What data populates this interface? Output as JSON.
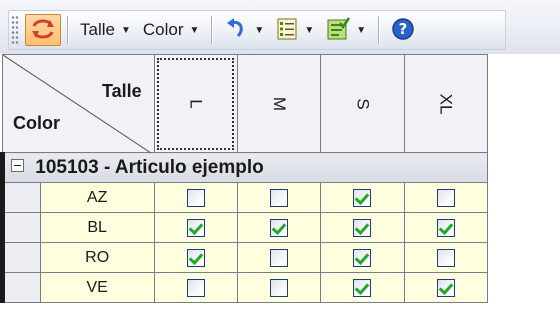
{
  "toolbar": {
    "talle_label": "Talle",
    "color_label": "Color",
    "icons": [
      "swap-icon",
      "undo-icon",
      "list-icon",
      "checklist-icon",
      "help-icon"
    ]
  },
  "grid": {
    "corner_talle": "Talle",
    "corner_color": "Color",
    "columns": [
      "L",
      "M",
      "S",
      "XL"
    ],
    "selected_column": "L",
    "group_label": "105103 - Articulo ejemplo",
    "rows": [
      {
        "label": "AZ",
        "checks": [
          false,
          false,
          true,
          false
        ]
      },
      {
        "label": "BL",
        "checks": [
          true,
          true,
          true,
          true
        ]
      },
      {
        "label": "RO",
        "checks": [
          true,
          false,
          true,
          false
        ]
      },
      {
        "label": "VE",
        "checks": [
          false,
          false,
          true,
          true
        ]
      }
    ]
  }
}
